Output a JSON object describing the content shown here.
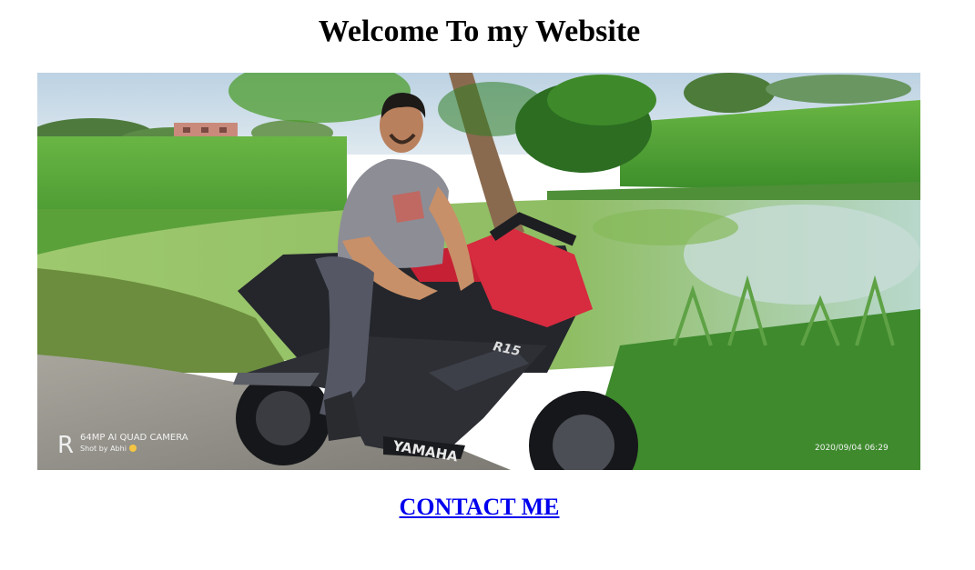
{
  "page": {
    "title": "Welcome To my Website",
    "contact_link": "CONTACT ME"
  },
  "photo": {
    "watermark_line1": "64MP AI QUAD CAMERA",
    "watermark_line2": "Shot by Abhi",
    "timestamp": "2020/09/04 06:29",
    "bike_brand": "YAMAHA",
    "bike_model": "R15"
  },
  "colors": {
    "link": "#0000ee",
    "title": "#000000",
    "background": "#ffffff"
  }
}
